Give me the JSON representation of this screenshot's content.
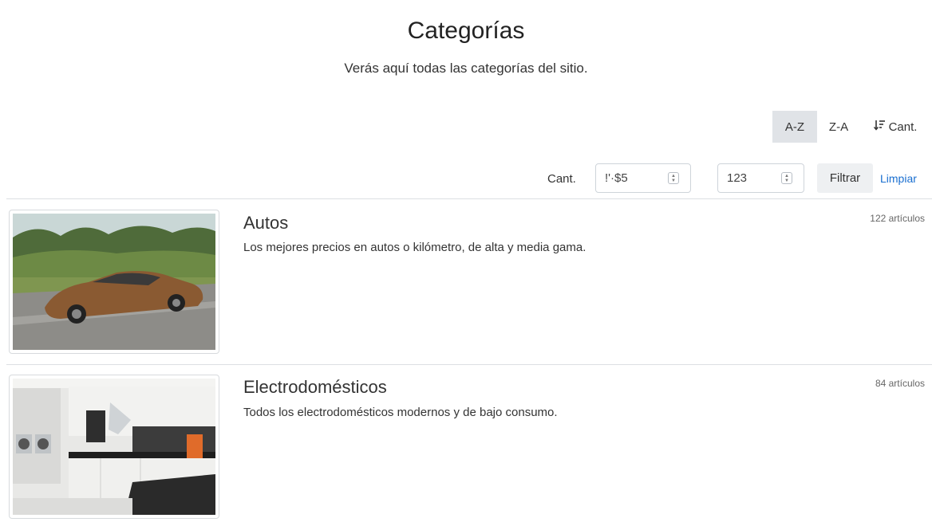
{
  "header": {
    "title": "Categorías",
    "subtitle": "Verás aquí todas las categorías del sitio."
  },
  "sort": {
    "az_label": "A-Z",
    "za_label": "Z-A",
    "count_label": "Cant.",
    "active": "A-Z"
  },
  "filter": {
    "label": "Cant.",
    "min_value": "!'·$5",
    "max_value": "123",
    "filter_label": "Filtrar",
    "clear_label": "Limpiar"
  },
  "categories": [
    {
      "name": "Autos",
      "description": "Los mejores precios en autos o kilómetro, de alta y media gama.",
      "count": "122 artículos",
      "image_icon": "car-photo"
    },
    {
      "name": "Electrodomésticos",
      "description": "Todos los electrodomésticos modernos y de bajo consumo.",
      "count": "84 artículos",
      "image_icon": "kitchen-photo"
    }
  ],
  "colors": {
    "accent_link": "#1a6fd0",
    "active_sort_bg": "#e0e3e7",
    "filter_btn_bg": "#eef0f2"
  }
}
